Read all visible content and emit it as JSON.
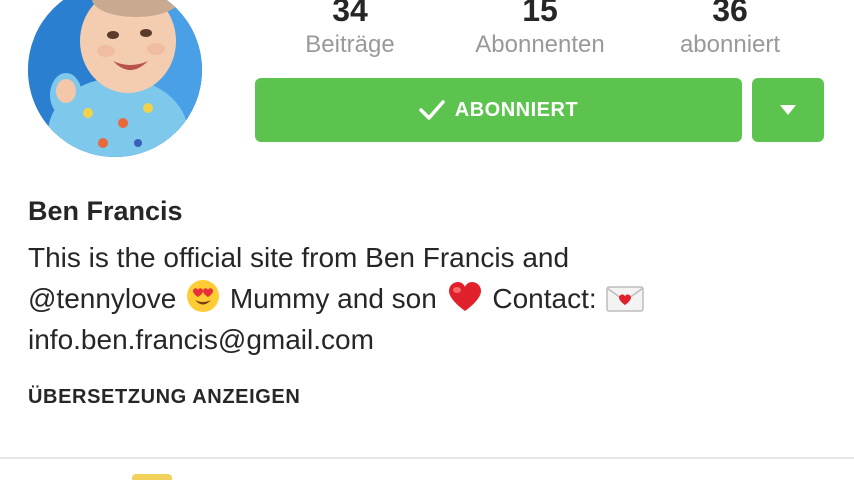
{
  "profile": {
    "avatar_icon": "profile-photo-baby",
    "stats": [
      {
        "value": "34",
        "label": "Beiträge"
      },
      {
        "value": "15",
        "label": "Abonnenten"
      },
      {
        "value": "36",
        "label": "abonniert"
      }
    ],
    "follow_button_label": "ABONNIERT",
    "follow_button_icon": "check-icon",
    "dropdown_icon": "caret-down-icon",
    "button_color": "#5cc44e",
    "name": "Ben Francis",
    "bio": {
      "line1": "This is the official site from Ben Francis and",
      "line2_part1": "@tennylove",
      "line2_part2": "Mummy and son",
      "line2_part3": "Contact:",
      "line3": "info.ben.francis@gmail.com"
    },
    "translate_label": "ÜBERSETZUNG ANZEIGEN"
  }
}
